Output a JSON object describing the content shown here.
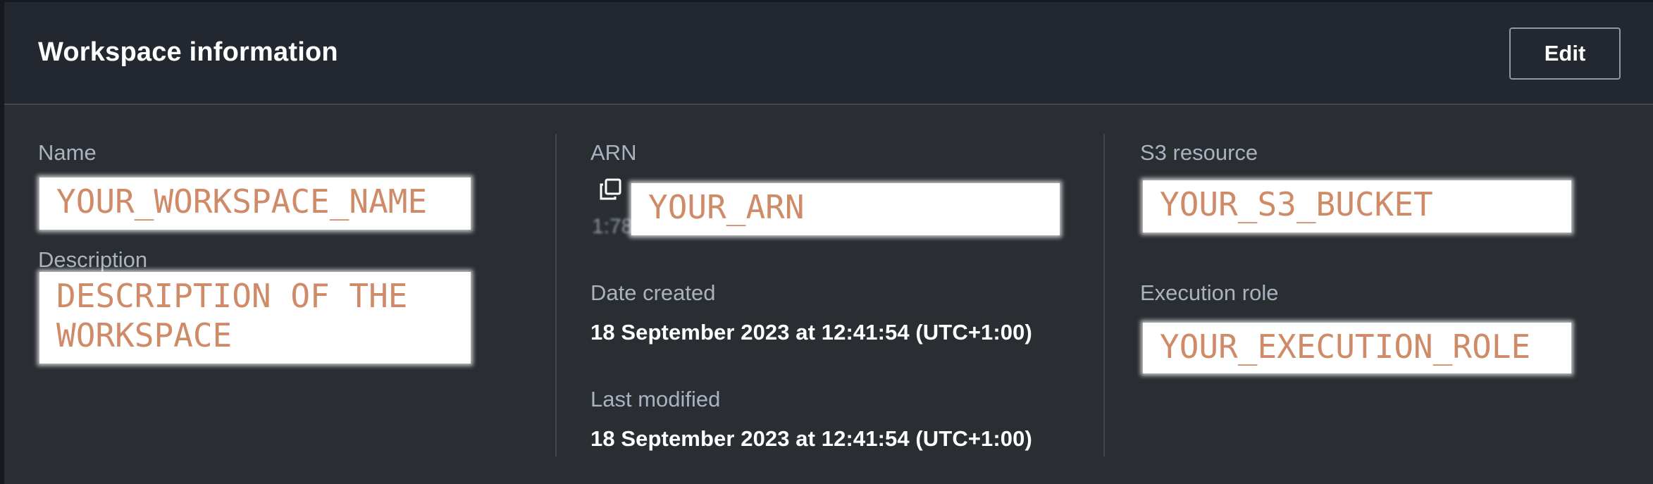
{
  "header": {
    "title": "Workspace information",
    "edit_label": "Edit"
  },
  "columns": {
    "left": {
      "name_label": "Name",
      "name_value": "YOUR_WORKSPACE_NAME",
      "description_label": "Description",
      "description_value": "DESCRIPTION OF THE WORKSPACE"
    },
    "middle": {
      "arn_label": "ARN",
      "arn_value": "YOUR_ARN",
      "arn_partial_text": "1:78",
      "date_created_label": "Date created",
      "date_created_value": "18 September 2023 at 12:41:54 (UTC+1:00)",
      "last_modified_label": "Last modified",
      "last_modified_value": "18 September 2023 at 12:41:54 (UTC+1:00)"
    },
    "right": {
      "s3_label": "S3 resource",
      "s3_value": "YOUR_S3_BUCKET",
      "execution_role_label": "Execution role",
      "execution_role_value": "YOUR_EXECUTION_ROLE"
    }
  },
  "icons": {
    "copy": "copy-icon"
  },
  "colors": {
    "header_bg": "#232730",
    "panel_bg": "#2a2e33",
    "label": "#a9b3bf",
    "value": "#ffffff",
    "redaction_text": "#cf8a68"
  }
}
